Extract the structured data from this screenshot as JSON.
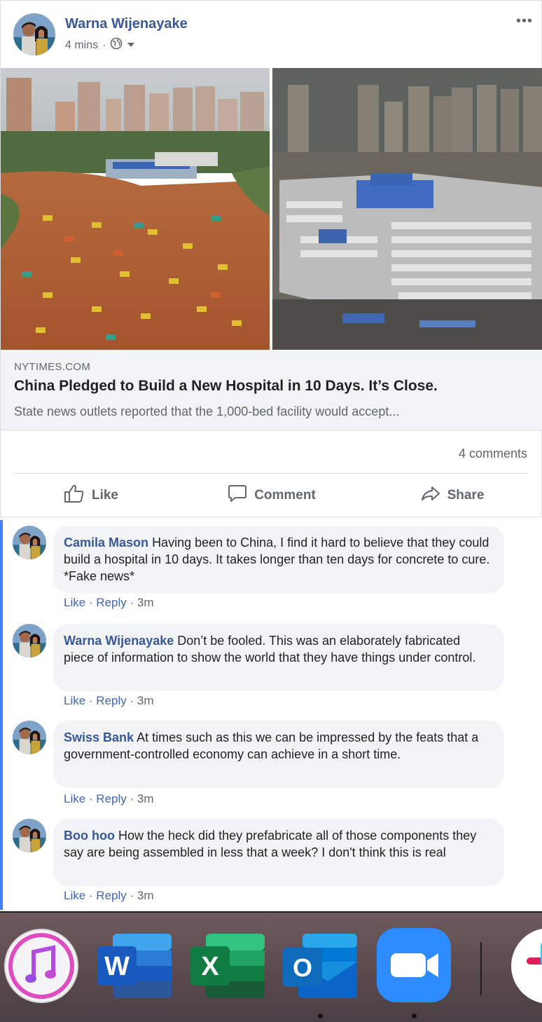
{
  "post": {
    "author": "Warna Wijenayake",
    "time": "4 mins",
    "separator": "·",
    "more_label": "•••",
    "link": {
      "domain": "NYTIMES.COM",
      "title": "China Pledged to Build a New Hospital in 10 Days. It’s Close.",
      "description": "State news outlets reported that the 1,000-bed facility would accept..."
    },
    "comments_count": "4 comments",
    "actions": {
      "like": "Like",
      "comment": "Comment",
      "share": "Share"
    }
  },
  "comments": [
    {
      "name": "Camila Mason",
      "text": "Having been to China, I find it hard to believe that they could build a hospital in 10 days. It takes longer than ten days for concrete to cure. *Fake news*",
      "like": "Like",
      "reply": "Reply",
      "time": "3m"
    },
    {
      "name": "Warna Wijenayake",
      "text": "Don’t be fooled. This was an elaborately fabricated piece of information to show the world that they have things under control.",
      "like": "Like",
      "reply": "Reply",
      "time": "3m"
    },
    {
      "name": "Swiss Bank",
      "text": "At times such as this we can be impressed by the feats that a government-controlled economy can achieve in a short time.",
      "like": "Like",
      "reply": "Reply",
      "time": "3m"
    },
    {
      "name": "Boo hoo",
      "text": "How the heck did they prefabricate all of those components they say are being assembled in less that a week? I don't think this is real",
      "like": "Like",
      "reply": "Reply",
      "time": "3m"
    }
  ],
  "dock": {
    "apps": [
      {
        "name": "itunes-icon",
        "running": false
      },
      {
        "name": "word-icon",
        "letter": "W",
        "running": false
      },
      {
        "name": "excel-icon",
        "letter": "X",
        "running": false
      },
      {
        "name": "outlook-icon",
        "letter": "O",
        "running": true
      },
      {
        "name": "zoom-icon",
        "running": true
      },
      {
        "name": "slack-icon",
        "running": false
      }
    ]
  },
  "colors": {
    "link_blue": "#385898",
    "meta_gray": "#606770",
    "bubble_bg": "#f2f3f5",
    "accent_bar": "#4080ff",
    "word": "#2b579a",
    "excel": "#217346",
    "outlook": "#0078d4",
    "zoom": "#2d8cff"
  }
}
